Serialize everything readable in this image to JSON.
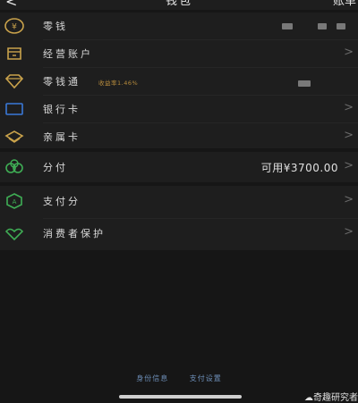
{
  "header": {
    "back_icon": "chevron-left-icon",
    "title": "钱包",
    "right_label": "账单"
  },
  "wallet_items": [
    {
      "label": "零钱",
      "icon": "coin-icon"
    },
    {
      "label": "经营账户",
      "icon": "store-icon"
    },
    {
      "label": "零钱通",
      "icon": "diamond-icon",
      "sub": "收益率1.46%"
    },
    {
      "label": "银行卡",
      "icon": "card-icon"
    },
    {
      "label": "亲属卡",
      "icon": "family-card-icon"
    }
  ],
  "installment": {
    "label": "分付",
    "icon": "installment-icon",
    "value": "可用¥3700.00"
  },
  "services": [
    {
      "label": "支付分",
      "icon": "score-icon"
    },
    {
      "label": "消费者保护",
      "icon": "protection-icon"
    }
  ],
  "footer": {
    "identity_link": "身份信息",
    "settings_link": "支付设置"
  },
  "watermark": "奇趣研究者",
  "colors": {
    "background": "#161616",
    "panel": "#1e1e1e",
    "icon_gold": "#c9a24b",
    "icon_blue": "#3a78d8",
    "icon_green": "#3fae55",
    "link": "#6d8fb8"
  }
}
